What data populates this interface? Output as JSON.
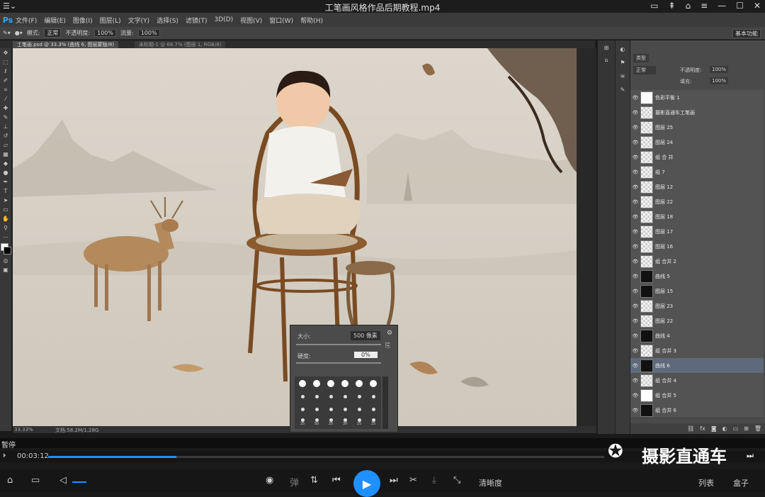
{
  "player": {
    "title": "工笔画风格作品后期教程.mp4",
    "status": "暂停",
    "time": "00:03:12",
    "progress": 0.23,
    "bottom_buttons": {
      "clarity": "清晰度",
      "list": "列表",
      "box": "盒子",
      "danmaku": "弹"
    },
    "watermark": "摄影直通车"
  },
  "ps": {
    "logo": "Ps",
    "menu": [
      "文件(F)",
      "编辑(E)",
      "图像(I)",
      "图层(L)",
      "文字(Y)",
      "选择(S)",
      "滤镜(T)",
      "3D(D)",
      "视图(V)",
      "窗口(W)",
      "帮助(H)"
    ],
    "options": {
      "mode_label": "模式:",
      "mode_value": "正常",
      "opacity_label": "不透明度:",
      "opacity_value": "100%",
      "flow_label": "流量:",
      "flow_value": "100%",
      "workspace": "基本功能"
    },
    "doc_tabs": [
      "工笔画.psd @ 33.3% (曲线 6, 图层蒙版/8)",
      "未标题-1 @ 66.7% (图层 1, RGB/8)"
    ],
    "status_zoom": "33.33%",
    "status_doc": "文档:58.2M/1.28G",
    "brush_popup": {
      "size_label": "大小:",
      "size_value": "500 像素",
      "hardness_label": "硬度:",
      "hardness_value": "0%",
      "presets": [
        "",
        "",
        "",
        "",
        "",
        "",
        "",
        "",
        "",
        "",
        "",
        "",
        "",
        "",
        "",
        "",
        "",
        "",
        "25",
        "50",
        "25",
        "30",
        "25",
        "25"
      ]
    },
    "layers_panel": {
      "kind_filter": "类型",
      "blend_mode": "正常",
      "opacity_label": "不透明度:",
      "opacity_value": "100%",
      "fill_label": "填充:",
      "fill_value": "100%",
      "layers": [
        {
          "name": "色彩平衡 1",
          "thumb": "white"
        },
        {
          "name": "摄影直通车工笔画",
          "thumb": "text"
        },
        {
          "name": "图层 25",
          "thumb": "check"
        },
        {
          "name": "图层 24",
          "thumb": "check"
        },
        {
          "name": "组 合 并",
          "thumb": "folder"
        },
        {
          "name": "组 7",
          "thumb": "folder"
        },
        {
          "name": "图层 12",
          "thumb": "check"
        },
        {
          "name": "图层 22",
          "thumb": "check"
        },
        {
          "name": "图层 18",
          "thumb": "check"
        },
        {
          "name": "图层 17",
          "thumb": "check"
        },
        {
          "name": "图层 16",
          "thumb": "check"
        },
        {
          "name": "组 合并 2",
          "thumb": "check"
        },
        {
          "name": "曲线 5",
          "thumb": "black"
        },
        {
          "name": "图层 15",
          "thumb": "black"
        },
        {
          "name": "图层 23",
          "thumb": "check"
        },
        {
          "name": "图层 22",
          "thumb": "check"
        },
        {
          "name": "曲线 4",
          "thumb": "black"
        },
        {
          "name": "组 合并 3",
          "thumb": "check"
        },
        {
          "name": "曲线 6",
          "thumb": "black"
        },
        {
          "name": "组 合并 4",
          "thumb": "check"
        },
        {
          "name": "组 合并 5",
          "thumb": "white"
        },
        {
          "name": "组 合并 6",
          "thumb": "black"
        }
      ]
    }
  }
}
